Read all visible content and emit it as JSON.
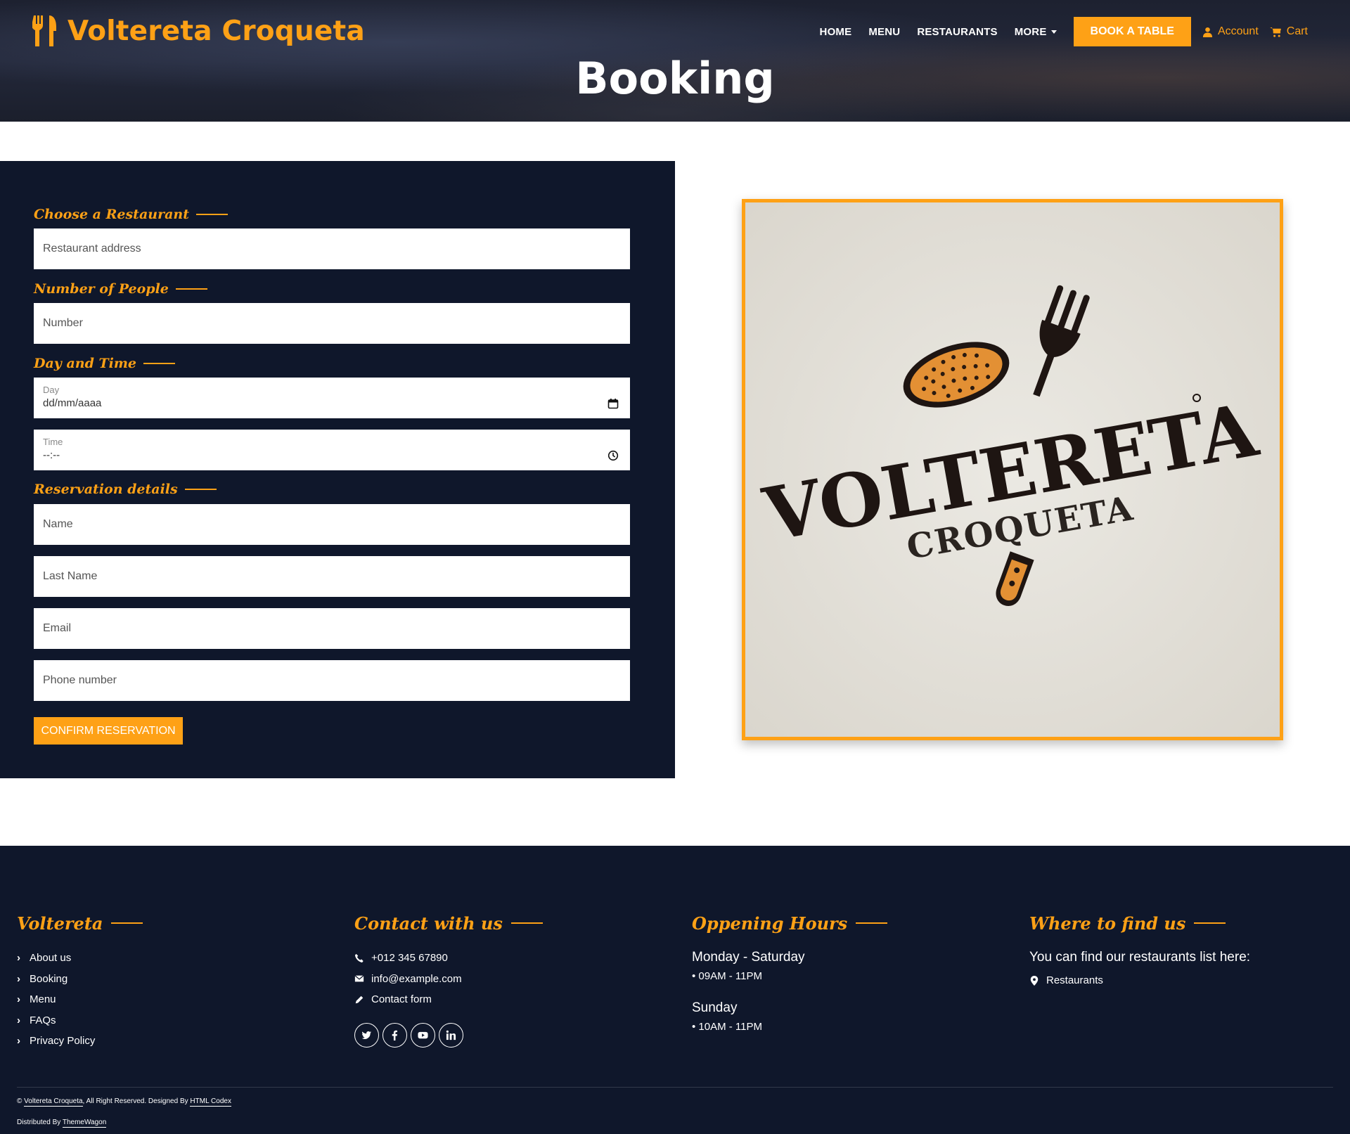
{
  "brand": {
    "name": "Voltereta Croqueta"
  },
  "nav": {
    "items": [
      "HOME",
      "MENU",
      "RESTAURANTS",
      "MORE"
    ],
    "book_label": "BOOK A TABLE",
    "account_label": "Account",
    "cart_label": "Cart"
  },
  "page": {
    "title": "Booking"
  },
  "form": {
    "restaurant_heading": "Choose a Restaurant",
    "restaurant_placeholder": "Restaurant address",
    "people_heading": "Number of People",
    "people_placeholder": "Number",
    "datetime_heading": "Day and Time",
    "day_label": "Day",
    "day_value": "dd/mm/aaaa",
    "time_label": "Time",
    "time_value": "--:--",
    "details_heading": "Reservation details",
    "name_placeholder": "Name",
    "lastname_placeholder": "Last Name",
    "email_placeholder": "Email",
    "phone_placeholder": "Phone number",
    "confirm_label": "CONFIRM RESERVATION"
  },
  "logo_image": {
    "word1": "VOLTERETA",
    "word2": "CROQUETA"
  },
  "footer": {
    "col1": {
      "heading": "Voltereta",
      "links": [
        "About us",
        "Booking",
        "Menu",
        "FAQs",
        "Privacy Policy"
      ]
    },
    "col2": {
      "heading": "Contact with us",
      "phone": "+012 345 67890",
      "email": "info@example.com",
      "form": "Contact form",
      "socials": [
        "twitter-icon",
        "facebook-icon",
        "youtube-icon",
        "linkedin-icon"
      ]
    },
    "col3": {
      "heading": "Oppening Hours",
      "day1": "Monday - Saturday",
      "time1": "• 09AM - 11PM",
      "day2": "Sunday",
      "time2": "• 10AM - 11PM"
    },
    "col4": {
      "heading": "Where to find us",
      "text": "You can find our restaurants list here:",
      "link": "Restaurants"
    },
    "copyright": {
      "prefix": "©",
      "brand": "Voltereta Croqueta",
      "middle": ", All Right Reserved. Designed By",
      "designer": "HTML Codex",
      "dist_prefix": "Distributed By",
      "distributor": "ThemeWagon"
    }
  },
  "colors": {
    "accent": "#FEA116",
    "dark": "#0F172B",
    "white": "#FFFFFF"
  }
}
